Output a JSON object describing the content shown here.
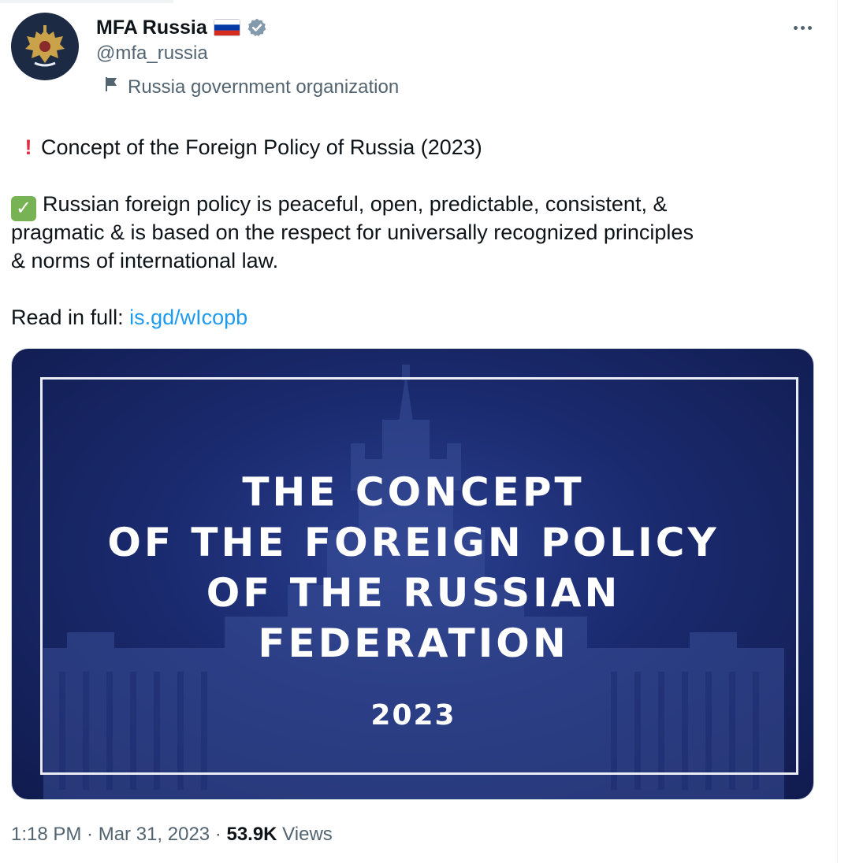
{
  "author": {
    "display_name": "MFA Russia",
    "handle": "@mfa_russia",
    "affiliation": "Russia government organization"
  },
  "tweet": {
    "line1": "Concept of the Foreign Policy of Russia (2023)",
    "line2": "Russian foreign policy is peaceful, open, predictable, consistent, &",
    "line3": "pragmatic & is based on the respect for universally recognized principles",
    "line4": "& norms of international law.",
    "read_label": "Read in full: ",
    "link_text": "is.gd/wIcopb"
  },
  "media": {
    "headline_lines": [
      "THE CONCEPT",
      "OF THE FOREIGN POLICY",
      "OF THE RUSSIAN",
      "FEDERATION"
    ],
    "year": "2023"
  },
  "footer": {
    "time": "1:18 PM",
    "separator": " · ",
    "date": "Mar 31, 2023",
    "views_count": "53.9K",
    "views_label": " Views"
  },
  "icons": {
    "exclamation": "exclamation-emoji",
    "check": "check-emoji",
    "verified": "verified-badge",
    "flag": "russia-flag",
    "affiliation": "flag-outline-icon",
    "more": "more-dots-icon"
  },
  "colors": {
    "text": "#0f1419",
    "secondary": "#536471",
    "link": "#1d9bf0",
    "media_bg": "#1a2a6e"
  }
}
